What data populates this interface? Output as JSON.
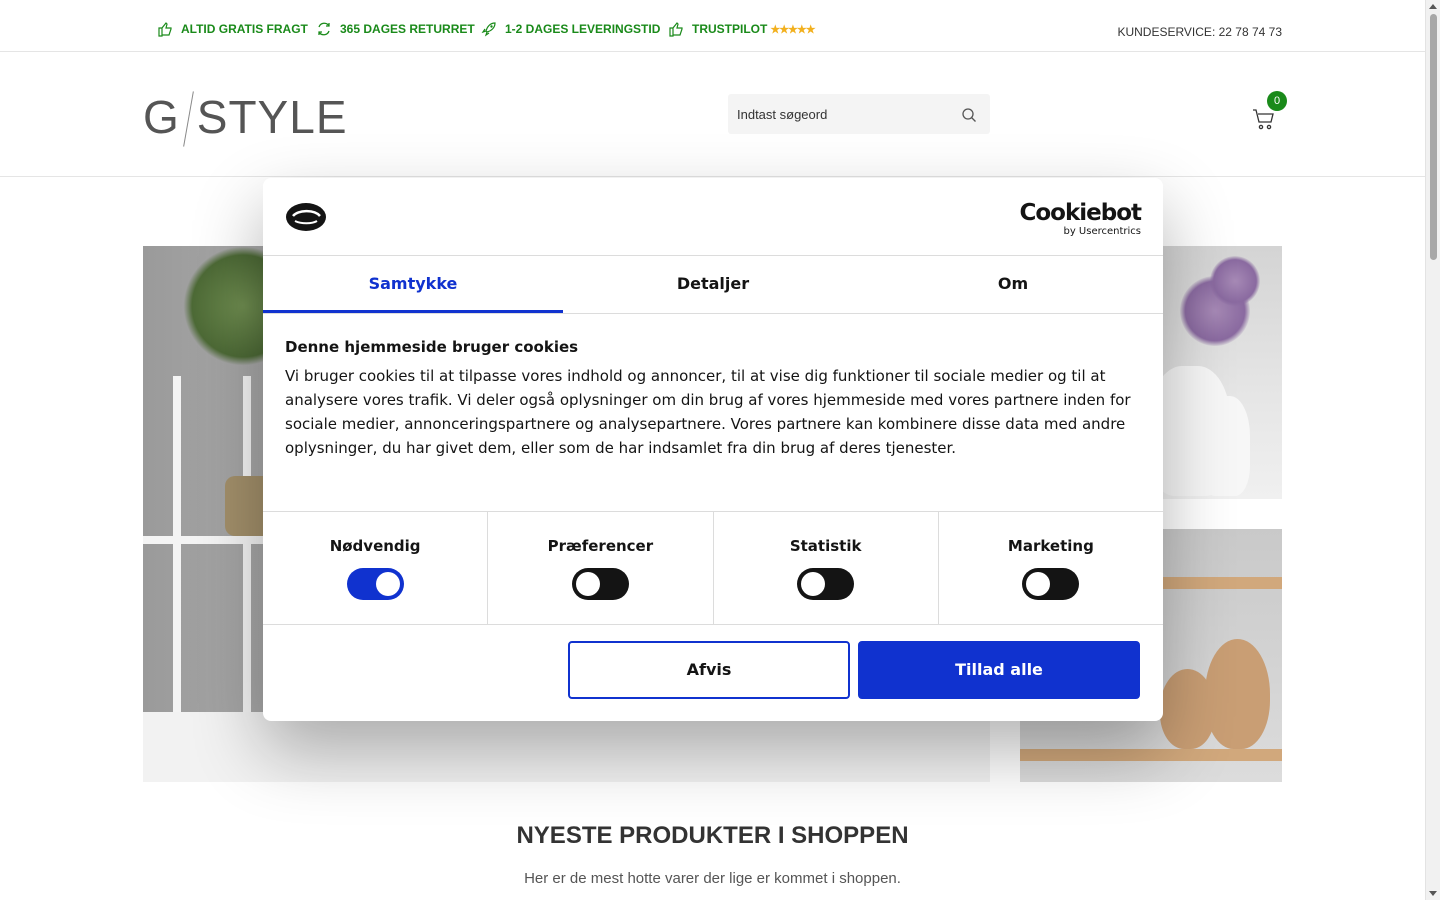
{
  "topbar": {
    "usps": [
      {
        "label": "ALTID GRATIS FRAGT",
        "icon": "thumbs-up-icon"
      },
      {
        "label": "365 DAGES RETURRET",
        "icon": "refresh-icon"
      },
      {
        "label": "1-2 DAGES LEVERINGSTID",
        "icon": "rocket-icon"
      },
      {
        "label": "TRUSTPILOT",
        "icon": "thumbs-up-icon",
        "stars": "★★★★★"
      }
    ],
    "customer_service": "KUNDESERVICE: 22 78 74 73"
  },
  "header": {
    "logo_left": "G",
    "logo_right": "STYLE",
    "search_placeholder": "Indtast søgeord",
    "cart_count": "0"
  },
  "section": {
    "title": "NYESTE PRODUKTER I SHOPPEN",
    "subtitle": "Her er de mest hotte varer der lige er kommet i shoppen."
  },
  "cookie_dialog": {
    "brand_name": "Cookiebot",
    "brand_by": "by Usercentrics",
    "tabs": [
      "Samtykke",
      "Detaljer",
      "Om"
    ],
    "active_tab": "Samtykke",
    "heading": "Denne hjemmeside bruger cookies",
    "text": "Vi bruger cookies til at tilpasse vores indhold og annoncer, til at vise dig funktioner til sociale medier og til at analysere vores trafik. Vi deler også oplysninger om din brug af vores hjemmeside med vores partnere inden for sociale medier, annonceringspartnere og analysepartnere. Vores partnere kan kombinere disse data med andre oplysninger, du har givet dem, eller som de har indsamlet fra din brug af deres tjenester.",
    "toggles": [
      {
        "label": "Nødvendig",
        "on": true
      },
      {
        "label": "Præferencer",
        "on": false
      },
      {
        "label": "Statistik",
        "on": false
      },
      {
        "label": "Marketing",
        "on": false
      }
    ],
    "reject_label": "Afvis",
    "allow_label": "Tillad alle"
  },
  "colors": {
    "usp_green": "#1a8a1a",
    "cookiebot_blue": "#1032cf",
    "stars": "#f2b01e"
  }
}
